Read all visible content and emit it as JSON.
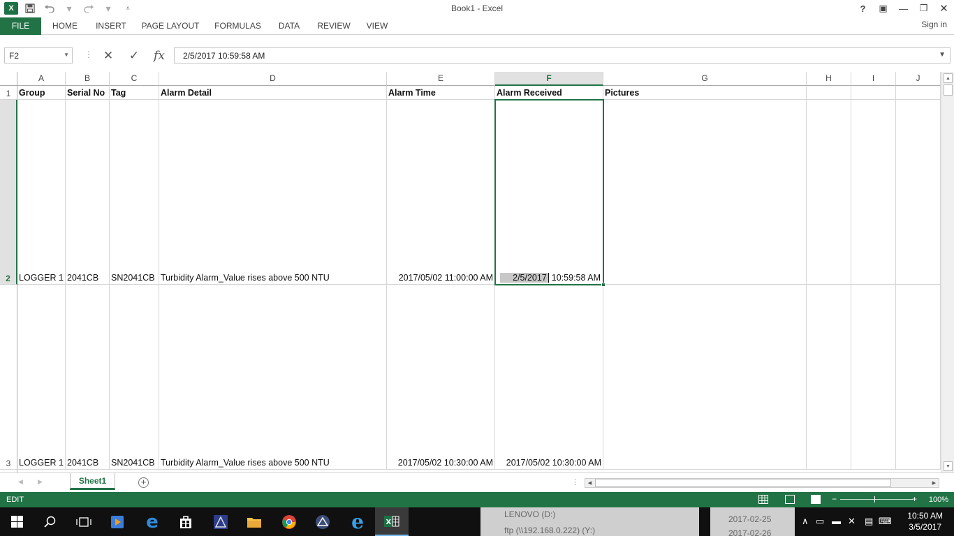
{
  "window": {
    "title": "Book1 - Excel",
    "help": "?",
    "ribbon_display": "▣",
    "minimize": "—",
    "restore": "❐",
    "close": "✕"
  },
  "qat": {
    "logo": "X",
    "save_icon": "save-icon",
    "undo_icon": "undo-icon",
    "redo_icon": "redo-icon",
    "customize_icon": "customize-icon"
  },
  "ribbon": {
    "tabs": [
      "FILE",
      "HOME",
      "INSERT",
      "PAGE LAYOUT",
      "FORMULAS",
      "DATA",
      "REVIEW",
      "VIEW"
    ],
    "signin": "Sign in"
  },
  "formula_bar": {
    "name_box": "F2",
    "cancel": "✕",
    "enter": "✓",
    "fx": "fx",
    "value": "2/5/2017  10:59:58 AM"
  },
  "sheet": {
    "columns": [
      "A",
      "B",
      "C",
      "D",
      "E",
      "F",
      "G",
      "H",
      "I",
      "J"
    ],
    "selected_column": "F",
    "rows": [
      "1",
      "2",
      "3"
    ],
    "selected_row": "2",
    "header_row": [
      "Group",
      "Serial No",
      "Tag",
      "Alarm Detail",
      "Alarm Time",
      "Alarm Received",
      "Pictures"
    ],
    "data_rows": [
      [
        "LOGGER 1",
        "2041CB",
        "SN2041CB",
        "Turbidity Alarm_Value rises above 500 NTU",
        "2017/05/02 11:00:00 AM",
        "2/5/2017",
        "10:59:58 AM"
      ],
      [
        "LOGGER 1",
        "2041CB",
        "SN2041CB",
        "Turbidity Alarm_Value rises above 500 NTU",
        "2017/05/02 10:30:00 AM",
        "2017/05/02 10:30:00 AM"
      ]
    ],
    "active_cell": "F2"
  },
  "sheet_tabs": {
    "names": [
      "Sheet1"
    ],
    "add": "+"
  },
  "status": {
    "mode": "EDIT",
    "zoom": "100%",
    "minus": "−",
    "plus": "+"
  },
  "taskbar": {
    "background_items": [
      "LENOVO (D:)",
      "ftp (\\\\192.168.0.222) (Y:)",
      "2017-02-25",
      "2017-02-26"
    ],
    "time": "10:50 AM",
    "date": "3/5/2017"
  },
  "colors": {
    "excel_green": "#217346",
    "taskbar": "#101010"
  }
}
